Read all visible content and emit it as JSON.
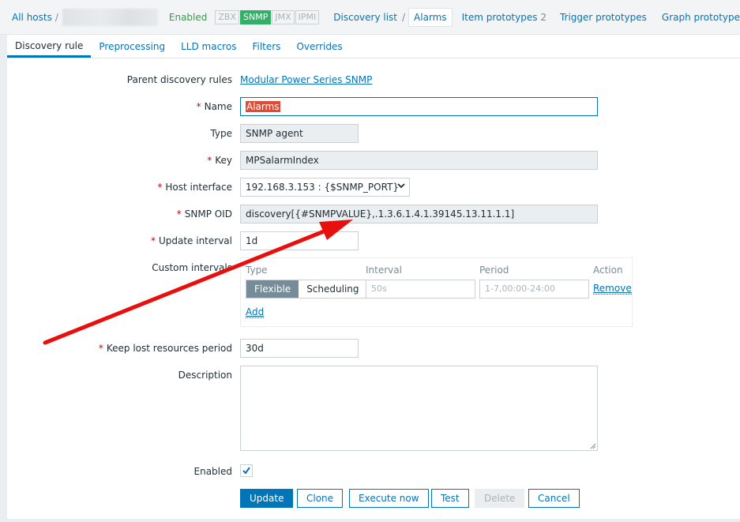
{
  "topnav": {
    "all_hosts": "All hosts",
    "separator": "/",
    "status": "Enabled",
    "availability": [
      "ZBX",
      "SNMP",
      "JMX",
      "IPMI"
    ],
    "discovery_list": "Discovery list",
    "crumb_sep": "/",
    "current": "Alarms",
    "item_prototypes": "Item prototypes",
    "item_prototypes_count": "2",
    "trigger_prototypes": "Trigger prototypes",
    "graph_prototypes": "Graph prototype"
  },
  "tabs": [
    "Discovery rule",
    "Preprocessing",
    "LLD macros",
    "Filters",
    "Overrides"
  ],
  "form": {
    "parent_label": "Parent discovery rules",
    "parent_value": "Modular Power Series SNMP",
    "required_mark": "*",
    "name_label": "Name",
    "name_value": "Alarms",
    "type_label": "Type",
    "type_value": "SNMP agent",
    "key_label": "Key",
    "key_value": "MPSalarmIndex",
    "host_interface_label": "Host interface",
    "host_interface_value": "192.168.3.153 : {$SNMP_PORT}",
    "snmp_oid_label": "SNMP OID",
    "snmp_oid_value": "discovery[{#SNMPVALUE},.1.3.6.1.4.1.39145.13.11.1.1]",
    "update_interval_label": "Update interval",
    "update_interval_value": "1d",
    "custom_intervals_label": "Custom intervals",
    "ci_headers": {
      "type": "Type",
      "interval": "Interval",
      "period": "Period",
      "action": "Action"
    },
    "ci_flexible": "Flexible",
    "ci_scheduling": "Scheduling",
    "ci_interval_placeholder": "50s",
    "ci_period_placeholder": "1-7,00:00-24:00",
    "ci_remove": "Remove",
    "ci_add": "Add",
    "keep_lost_label": "Keep lost resources period",
    "keep_lost_value": "30d",
    "description_label": "Description",
    "enabled_label": "Enabled",
    "enabled_checked": true
  },
  "buttons": {
    "update": "Update",
    "clone": "Clone",
    "execute_now": "Execute now",
    "test": "Test",
    "delete": "Delete",
    "cancel": "Cancel"
  },
  "annotation": {
    "arrow_color": "#e8100e"
  }
}
